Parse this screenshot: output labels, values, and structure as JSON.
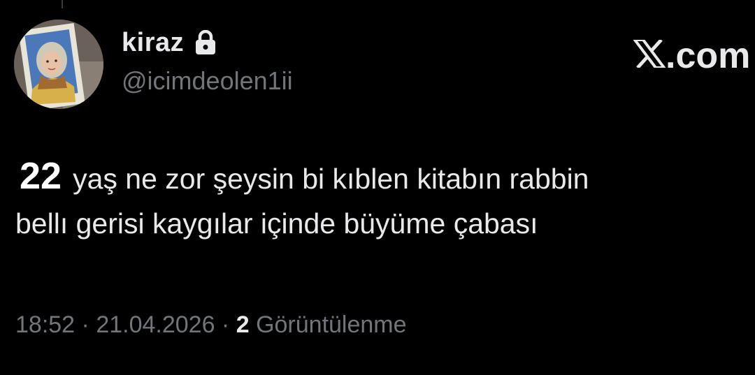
{
  "author": {
    "display_name": "kiraz",
    "handle": "@icimdeolen1ii",
    "protected_icon": "lock-icon",
    "avatar_icon": "profile-photo"
  },
  "watermark": {
    "logo_icon": "x-logo-icon",
    "suffix": ".com"
  },
  "tweet": {
    "number": "22",
    "line1": "yaş ne zor şeysin bi kıblen kitabın rabbin",
    "line2": "bellı gerisi kaygılar içinde büyüme çabası"
  },
  "meta": {
    "time": "18:52",
    "separator1": " · ",
    "date": "21.04.2026",
    "separator2": " · ",
    "views_count": "2",
    "views_label": " Görüntülenme"
  },
  "colors": {
    "background": "#000000",
    "primary_text": "#e7e9ea",
    "secondary_text": "#71767b"
  }
}
